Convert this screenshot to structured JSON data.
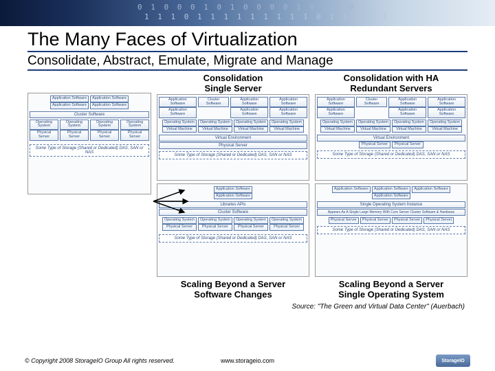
{
  "title": "The Many Faces of Virtualization",
  "subtitle": "Consolidate, Abstract, Emulate, Migrate and Manage",
  "columns": {
    "top_left": "Consolidation\nSingle Server",
    "top_right": "Consolidation with HA\nRedundant Servers",
    "bottom_left": "Scaling Beyond a Server\nSoftware Changes",
    "bottom_right": "Scaling Beyond a Server\nSingle Operating System"
  },
  "labels": {
    "app_sw": "Application Software",
    "cluster_sw": "Cluster Software",
    "os": "Operating System",
    "vm": "Virtual Machine",
    "venv": "Virtual Environment",
    "pserver": "Physical Server",
    "storage": "Some Type of Storage (Shared or Dedicated) DAS, SAN or NAS",
    "lib_api": "Libraries APIs",
    "single_os": "Single Operating System Instance",
    "appears": "Appears As A Single Large Memory With Core Server Cluster Software & Hardware"
  },
  "source": "Source: \"The Green and Virtual Data Center\" (Auerbach)",
  "footer": {
    "copyright": "© Copyright 2008 StorageIO Group All rights reserved.",
    "url": "www.storageio.com",
    "logo": "StorageIO"
  }
}
